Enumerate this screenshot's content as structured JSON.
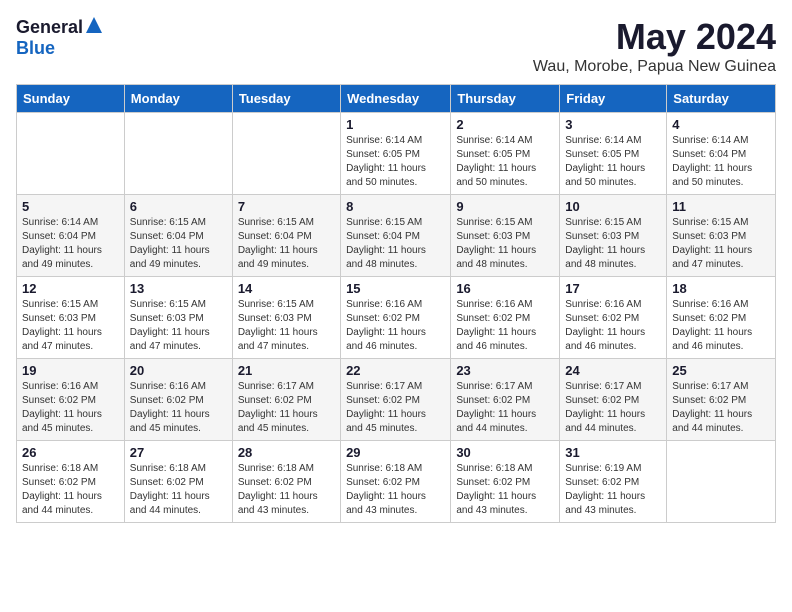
{
  "header": {
    "logo_general": "General",
    "logo_blue": "Blue",
    "title": "May 2024",
    "subtitle": "Wau, Morobe, Papua New Guinea"
  },
  "weekdays": [
    "Sunday",
    "Monday",
    "Tuesday",
    "Wednesday",
    "Thursday",
    "Friday",
    "Saturday"
  ],
  "weeks": [
    [
      {
        "day": "",
        "info": ""
      },
      {
        "day": "",
        "info": ""
      },
      {
        "day": "",
        "info": ""
      },
      {
        "day": "1",
        "info": "Sunrise: 6:14 AM\nSunset: 6:05 PM\nDaylight: 11 hours\nand 50 minutes."
      },
      {
        "day": "2",
        "info": "Sunrise: 6:14 AM\nSunset: 6:05 PM\nDaylight: 11 hours\nand 50 minutes."
      },
      {
        "day": "3",
        "info": "Sunrise: 6:14 AM\nSunset: 6:05 PM\nDaylight: 11 hours\nand 50 minutes."
      },
      {
        "day": "4",
        "info": "Sunrise: 6:14 AM\nSunset: 6:04 PM\nDaylight: 11 hours\nand 50 minutes."
      }
    ],
    [
      {
        "day": "5",
        "info": "Sunrise: 6:14 AM\nSunset: 6:04 PM\nDaylight: 11 hours\nand 49 minutes."
      },
      {
        "day": "6",
        "info": "Sunrise: 6:15 AM\nSunset: 6:04 PM\nDaylight: 11 hours\nand 49 minutes."
      },
      {
        "day": "7",
        "info": "Sunrise: 6:15 AM\nSunset: 6:04 PM\nDaylight: 11 hours\nand 49 minutes."
      },
      {
        "day": "8",
        "info": "Sunrise: 6:15 AM\nSunset: 6:04 PM\nDaylight: 11 hours\nand 48 minutes."
      },
      {
        "day": "9",
        "info": "Sunrise: 6:15 AM\nSunset: 6:03 PM\nDaylight: 11 hours\nand 48 minutes."
      },
      {
        "day": "10",
        "info": "Sunrise: 6:15 AM\nSunset: 6:03 PM\nDaylight: 11 hours\nand 48 minutes."
      },
      {
        "day": "11",
        "info": "Sunrise: 6:15 AM\nSunset: 6:03 PM\nDaylight: 11 hours\nand 47 minutes."
      }
    ],
    [
      {
        "day": "12",
        "info": "Sunrise: 6:15 AM\nSunset: 6:03 PM\nDaylight: 11 hours\nand 47 minutes."
      },
      {
        "day": "13",
        "info": "Sunrise: 6:15 AM\nSunset: 6:03 PM\nDaylight: 11 hours\nand 47 minutes."
      },
      {
        "day": "14",
        "info": "Sunrise: 6:15 AM\nSunset: 6:03 PM\nDaylight: 11 hours\nand 47 minutes."
      },
      {
        "day": "15",
        "info": "Sunrise: 6:16 AM\nSunset: 6:02 PM\nDaylight: 11 hours\nand 46 minutes."
      },
      {
        "day": "16",
        "info": "Sunrise: 6:16 AM\nSunset: 6:02 PM\nDaylight: 11 hours\nand 46 minutes."
      },
      {
        "day": "17",
        "info": "Sunrise: 6:16 AM\nSunset: 6:02 PM\nDaylight: 11 hours\nand 46 minutes."
      },
      {
        "day": "18",
        "info": "Sunrise: 6:16 AM\nSunset: 6:02 PM\nDaylight: 11 hours\nand 46 minutes."
      }
    ],
    [
      {
        "day": "19",
        "info": "Sunrise: 6:16 AM\nSunset: 6:02 PM\nDaylight: 11 hours\nand 45 minutes."
      },
      {
        "day": "20",
        "info": "Sunrise: 6:16 AM\nSunset: 6:02 PM\nDaylight: 11 hours\nand 45 minutes."
      },
      {
        "day": "21",
        "info": "Sunrise: 6:17 AM\nSunset: 6:02 PM\nDaylight: 11 hours\nand 45 minutes."
      },
      {
        "day": "22",
        "info": "Sunrise: 6:17 AM\nSunset: 6:02 PM\nDaylight: 11 hours\nand 45 minutes."
      },
      {
        "day": "23",
        "info": "Sunrise: 6:17 AM\nSunset: 6:02 PM\nDaylight: 11 hours\nand 44 minutes."
      },
      {
        "day": "24",
        "info": "Sunrise: 6:17 AM\nSunset: 6:02 PM\nDaylight: 11 hours\nand 44 minutes."
      },
      {
        "day": "25",
        "info": "Sunrise: 6:17 AM\nSunset: 6:02 PM\nDaylight: 11 hours\nand 44 minutes."
      }
    ],
    [
      {
        "day": "26",
        "info": "Sunrise: 6:18 AM\nSunset: 6:02 PM\nDaylight: 11 hours\nand 44 minutes."
      },
      {
        "day": "27",
        "info": "Sunrise: 6:18 AM\nSunset: 6:02 PM\nDaylight: 11 hours\nand 44 minutes."
      },
      {
        "day": "28",
        "info": "Sunrise: 6:18 AM\nSunset: 6:02 PM\nDaylight: 11 hours\nand 43 minutes."
      },
      {
        "day": "29",
        "info": "Sunrise: 6:18 AM\nSunset: 6:02 PM\nDaylight: 11 hours\nand 43 minutes."
      },
      {
        "day": "30",
        "info": "Sunrise: 6:18 AM\nSunset: 6:02 PM\nDaylight: 11 hours\nand 43 minutes."
      },
      {
        "day": "31",
        "info": "Sunrise: 6:19 AM\nSunset: 6:02 PM\nDaylight: 11 hours\nand 43 minutes."
      },
      {
        "day": "",
        "info": ""
      }
    ]
  ]
}
